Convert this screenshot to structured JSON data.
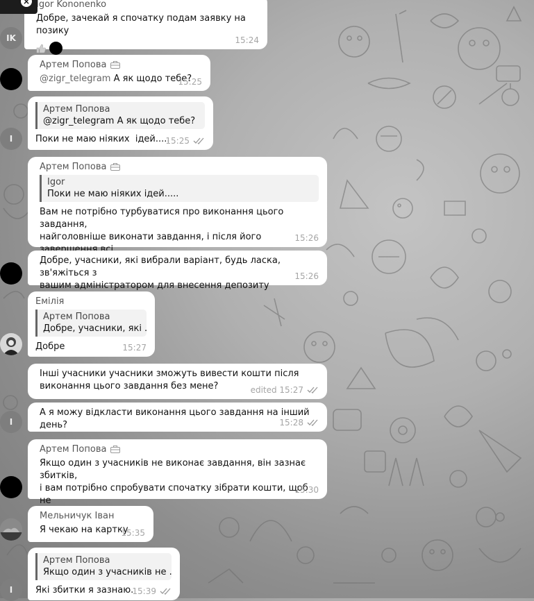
{
  "close_icon": "×",
  "messages": [
    {
      "sender": "Igor Kononenko",
      "text": "Добре, зачекай я спочатку подам заявку на позику",
      "time": "15:24",
      "avatar": "IK"
    },
    {
      "sender": "Артем Попова",
      "mention": "@zigr_telegram",
      "text": " А як щодо тебе?",
      "time": "15:25"
    },
    {
      "reply_name": "Артем Попова",
      "reply_text": "@zigr_telegram А як щодо тебе?",
      "text": "Поки не маю ніяких  ідей.....",
      "time": "15:25",
      "avatar": "I"
    },
    {
      "sender": "Артем Попова",
      "reply_name": "Igor",
      "reply_text": "Поки не маю ніяких  ідей.....",
      "text": "Вам не потрібно турбуватися про виконання цього завдання,\nнайголовніше виконати завдання, і після його завершення всі\nучасники можуть вивести свої кошти",
      "time": "15:26"
    },
    {
      "text": "Добре, учасники, які вибрали варіант, будь ласка, зв'яжіться з\nвашим адміністратором для внесення депозиту",
      "time": "15:26"
    },
    {
      "sender": "Емілія",
      "reply_name": "Артем Попова",
      "reply_text": "Добре, учасники, які ...",
      "text": "Добре",
      "time": "15:27"
    },
    {
      "text": "Інші учасники учасники зможуть вивести кошти після\nвиконання цього завдання без мене?",
      "time": "edited 15:27"
    },
    {
      "text": "А я можу відкласти виконання цього завдання на інший день?",
      "time": "15:28",
      "avatar": "I"
    },
    {
      "sender": "Артем Попова",
      "text": "Якщо один з учасників не виконає завдання, він зазнає збитків,\nі вам потрібно спробувати спочатку зібрати кошти, щоб не\nзазнати збитків",
      "time": "15:30"
    },
    {
      "sender": "Мельничук Іван",
      "text": "Я чекаю на картку",
      "time": "15:35"
    },
    {
      "reply_name": "Артем Попова",
      "reply_text": "Якщо один з учасників не ...",
      "text": "Які збитки я зазнаю.",
      "time": "15:39",
      "avatar": "I"
    }
  ]
}
